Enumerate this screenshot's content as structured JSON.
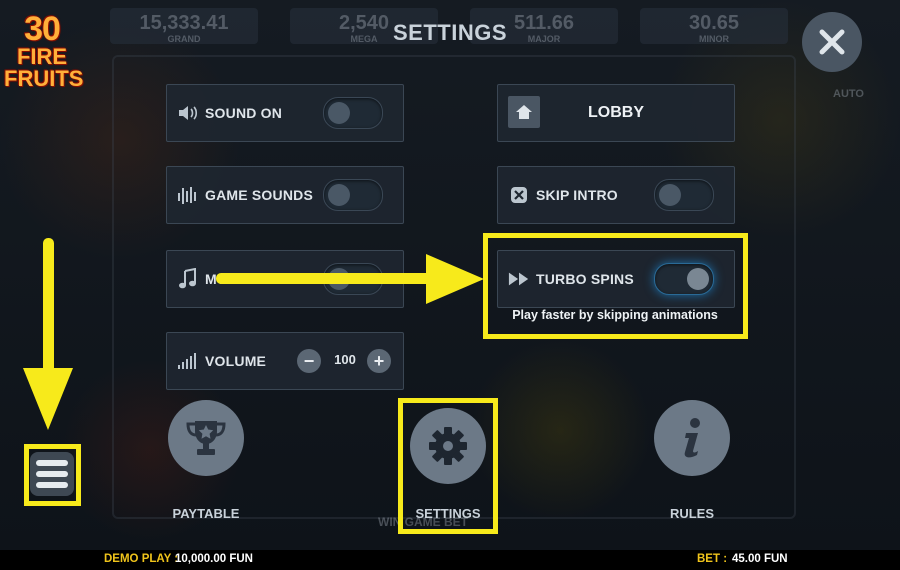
{
  "game": {
    "logo_number": "30",
    "logo_word1": "FIRE",
    "logo_word2": "FRUITS"
  },
  "jackpots": [
    {
      "value": "15,333.41",
      "label": "GRAND"
    },
    {
      "value": "2,540",
      "label": "MEGA"
    },
    {
      "value": "511.66",
      "label": "MAJOR"
    },
    {
      "value": "30.65",
      "label": "MINOR"
    }
  ],
  "dialog": {
    "title": "SETTINGS",
    "auto_label": "AUTO"
  },
  "settings": {
    "sound_on": {
      "label": "SOUND ON",
      "state": "off"
    },
    "game_sounds": {
      "label": "GAME SOUNDS",
      "state": "off"
    },
    "music": {
      "label": "MUSIC",
      "state": "off"
    },
    "volume": {
      "label": "VOLUME",
      "value": "100",
      "minus": "−",
      "plus": "+"
    },
    "lobby": {
      "label": "LOBBY"
    },
    "skip_intro": {
      "label": "SKIP INTRO",
      "state": "off"
    },
    "turbo_spins": {
      "label": "TURBO SPINS",
      "state": "on",
      "hint": "Play faster by skipping animations"
    }
  },
  "menu": {
    "paytable": "PAYTABLE",
    "settings": "SETTINGS",
    "rules": "RULES",
    "behind_text": "WIN GAME BET"
  },
  "footer": {
    "demo_label": "DEMO PLAY :",
    "demo_value": "10,000.00 FUN",
    "bet_label": "BET :",
    "bet_value": "45.00 FUN"
  },
  "colors": {
    "highlight": "#f7ea1b",
    "toggle_glow": "#1e6fa8",
    "footer_accent": "#f0c41b"
  }
}
